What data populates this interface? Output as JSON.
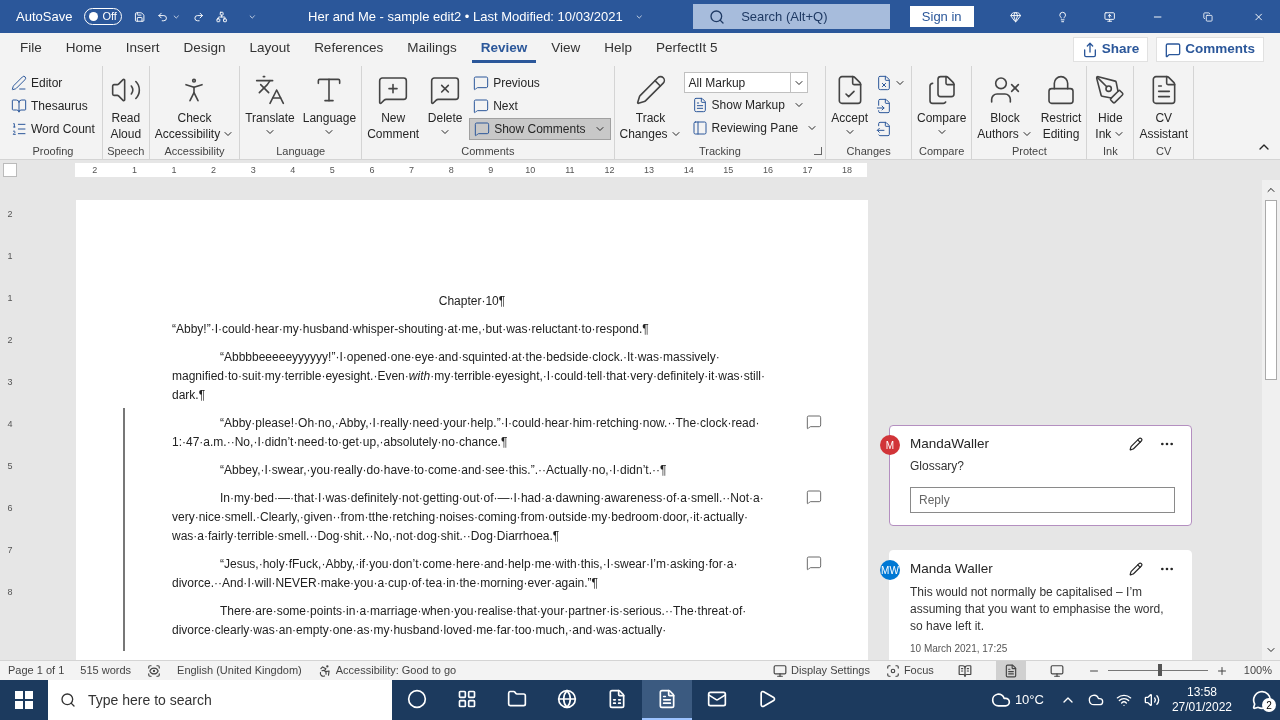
{
  "title_bar": {
    "autosave": {
      "label": "AutoSave",
      "on": false,
      "state_text": "Off"
    },
    "document_title": "Her and Me - sample edit2 • Last Modified: 10/03/2021",
    "search": {
      "placeholder": "Search (Alt+Q)"
    },
    "sign_in": "Sign in"
  },
  "menu_tabs": [
    {
      "label": "File",
      "selected": false
    },
    {
      "label": "Home",
      "selected": false
    },
    {
      "label": "Insert",
      "selected": false
    },
    {
      "label": "Design",
      "selected": false
    },
    {
      "label": "Layout",
      "selected": false
    },
    {
      "label": "References",
      "selected": false
    },
    {
      "label": "Mailings",
      "selected": false
    },
    {
      "label": "Review",
      "selected": true
    },
    {
      "label": "View",
      "selected": false
    },
    {
      "label": "Help",
      "selected": false
    },
    {
      "label": "PerfectIt 5",
      "selected": false
    }
  ],
  "share_button": "Share",
  "comments_button": "Comments",
  "ribbon": [
    {
      "label": "Proofing",
      "items": [
        {
          "kind": "small",
          "label": "Editor"
        },
        {
          "kind": "small",
          "label": "Thesaurus"
        },
        {
          "kind": "small",
          "label": "Word Count"
        }
      ]
    },
    {
      "label": "Speech",
      "items": [
        {
          "kind": "large",
          "lines": [
            "Read",
            "Aloud"
          ],
          "dropdown": false
        }
      ]
    },
    {
      "label": "Accessibility",
      "items": [
        {
          "kind": "large",
          "lines": [
            "Check",
            "Accessibility"
          ],
          "dropdown": true
        }
      ]
    },
    {
      "label": "Language",
      "items": [
        {
          "kind": "large",
          "lines": [
            "Translate"
          ],
          "dropdown": true
        },
        {
          "kind": "large",
          "lines": [
            "Language"
          ],
          "dropdown": true
        }
      ]
    },
    {
      "label": "Comments",
      "items": [
        {
          "kind": "large",
          "lines": [
            "New",
            "Comment"
          ],
          "dropdown": false
        },
        {
          "kind": "large",
          "lines": [
            "Delete"
          ],
          "dropdown": true
        },
        {
          "kind": "small",
          "label": "Previous"
        },
        {
          "kind": "small",
          "label": "Next"
        },
        {
          "kind": "small",
          "label": "Show Comments",
          "selected": true,
          "dropdown": true
        }
      ]
    },
    {
      "label": "Tracking",
      "launcher": true,
      "items": [
        {
          "kind": "large",
          "lines": [
            "Track",
            "Changes"
          ],
          "dropdown": true
        },
        {
          "kind": "select",
          "value": "All Markup"
        },
        {
          "kind": "small",
          "label": "Show Markup",
          "dropdown": true
        },
        {
          "kind": "small",
          "label": "Reviewing Pane",
          "dropdown": true
        }
      ]
    },
    {
      "label": "Changes",
      "items": [
        {
          "kind": "large",
          "lines": [
            "Accept"
          ],
          "dropdown": true
        },
        {
          "kind": "icon",
          "dropdown": true
        },
        {
          "kind": "icon",
          "dropdown": false
        },
        {
          "kind": "icon",
          "dropdown": false
        }
      ]
    },
    {
      "label": "Compare",
      "items": [
        {
          "kind": "large",
          "lines": [
            "Compare"
          ],
          "dropdown": true
        }
      ]
    },
    {
      "label": "Protect",
      "items": [
        {
          "kind": "large",
          "lines": [
            "Block",
            "Authors"
          ],
          "dropdown": true
        },
        {
          "kind": "large",
          "lines": [
            "Restrict",
            "Editing"
          ],
          "dropdown": false
        }
      ]
    },
    {
      "label": "Ink",
      "items": [
        {
          "kind": "large",
          "lines": [
            "Hide",
            "Ink"
          ],
          "dropdown": true
        }
      ]
    },
    {
      "label": "CV",
      "items": [
        {
          "kind": "large",
          "lines": [
            "CV",
            "Assistant"
          ],
          "dropdown": false
        }
      ]
    }
  ],
  "ruler": {
    "horizontal": [
      "2",
      "1",
      "1",
      "2",
      "3",
      "4",
      "5",
      "6",
      "7",
      "8",
      "9",
      "10",
      "11",
      "12",
      "13",
      "14",
      "15",
      "16",
      "17",
      "18"
    ],
    "vertical": [
      "2",
      "1",
      "1",
      "2",
      "3",
      "4",
      "5",
      "6",
      "7",
      "8"
    ]
  },
  "document": {
    "paragraphs": [
      {
        "kind": "heading",
        "text": "Chapter·10¶",
        "change_bar": false,
        "comment_marker": false
      },
      {
        "kind": "body",
        "indent": false,
        "text": "“Abby!”·I·could·hear·my·husband·whisper-shouting·at·me,·but·was·reluctant·to·respond.¶",
        "change_bar": false,
        "comment_marker": false
      },
      {
        "kind": "body",
        "indent": true,
        "text": "“Abbbbeeeeeyyyyyy!”·I·opened·one·eye·and·squinted·at·the·bedside·clock.·It·was·massively·magnified·to·suit·my·terrible·eyesight.·Even·*with*·my·terrible·eyesight,·I·could·tell·that·very·definitely·it·was·still·dark.¶",
        "change_bar": false,
        "comment_marker": false
      },
      {
        "kind": "body",
        "indent": true,
        "text": "“Abby·please!·Oh·no,·Abby,·I·really·need·your·help.”·I·could·hear·him·retching·now.··The·clock·read·1:·47·a.m.··No,·I·didn’t·need·to·get·up,·absolutely·no·chance.¶",
        "change_bar": true,
        "comment_marker": true
      },
      {
        "kind": "body",
        "indent": true,
        "text": "“Abbey,·I·swear,·you·really·do·have·to·come·and·see·this.”.··Actually·no,·I·didn’t.··¶",
        "change_bar": true,
        "comment_marker": false
      },
      {
        "kind": "body",
        "indent": true,
        "text": "In·my·bed·—·that·I·was·definitely·not·getting·out·of·—·I·had·a·dawning·awareness·of·a·smell.··Not·a·very·nice·smell.·Clearly,·given··from·tthe·retching·noises·coming·from·outside·my·bedroom·door,·it·actually·was·a·fairly·terrible·smell.··Dog·shit.··No,·not·dog·shit.··Dog·Diarrhoea.¶",
        "change_bar": true,
        "comment_marker": true
      },
      {
        "kind": "body",
        "indent": true,
        "text": "“Jesus,·holy·fFuck,·Abby,·if·you·don’t·come·here·and·help·me·with·this,·I·swear·I’m·asking·for·a·divorce.··And·I·will·NEVER·make·you·a·cup·of·tea·in·the·morning·ever·again.”¶",
        "change_bar": true,
        "comment_marker": true
      },
      {
        "kind": "body",
        "indent": true,
        "text": "There·are·some·points·in·a·marriage·when·you·realise·that·your·partner·is·serious.··The·threat·of·divorce·clearly·was·an·empty·one·as·my·husband·loved·me·far·too·much,·and·was·actually·",
        "change_bar": true,
        "comment_marker": false
      }
    ]
  },
  "comments": [
    {
      "author": "MandaWaller",
      "initials": "M",
      "color": "#d13438",
      "text": "Glossary?",
      "selected": true,
      "reply_placeholder": "Reply"
    },
    {
      "author": "Manda Waller",
      "initials": "MW",
      "color": "#0078d4",
      "text": "This would not normally be capitalised – I’m assuming that you want to emphasise the word, so have left it.",
      "date": "10 March 2021, 17:25",
      "selected": false
    }
  ],
  "status_bar": {
    "page": "Page 1 of 1",
    "words": "515 words",
    "language": "English (United Kingdom)",
    "accessibility": "Accessibility: Good to go",
    "display_settings": "Display Settings",
    "focus": "Focus",
    "views": [
      {
        "selected": false
      },
      {
        "selected": true
      },
      {
        "selected": false
      }
    ],
    "zoom": {
      "level": 0.5,
      "reading": "100%"
    }
  },
  "taskbar": {
    "search_placeholder": "Type here to search",
    "apps": [
      {
        "selected": false
      },
      {
        "selected": false
      },
      {
        "selected": false
      },
      {
        "selected": false
      },
      {
        "selected": false
      },
      {
        "selected": true
      },
      {
        "selected": false
      },
      {
        "selected": false
      }
    ],
    "temperature": "10°C",
    "time": "13:58",
    "date": "27/01/2022",
    "notifications": "2"
  }
}
